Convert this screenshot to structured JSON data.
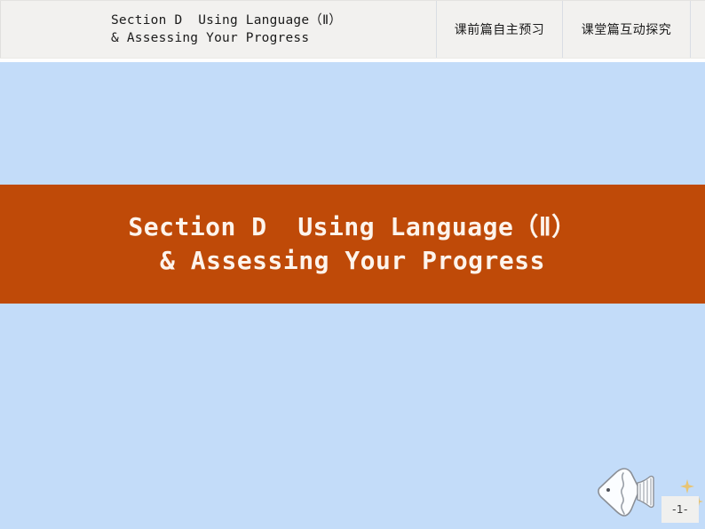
{
  "header": {
    "title_line1": "Section D  Using Language（Ⅱ）",
    "title_line2": "& Assessing Your Progress",
    "tabs": [
      {
        "label": "课前篇自主预习"
      },
      {
        "label": "课堂篇互动探究"
      }
    ]
  },
  "banner": {
    "line1": "Section D  Using Language（Ⅱ）",
    "line2": "& Assessing Your Progress"
  },
  "footer": {
    "page_number": "-1-"
  },
  "decorations": {
    "fish_icon": "fish-icon",
    "sparkle_icon": "sparkle-star-icon"
  },
  "colors": {
    "header_background": "#f2f1ef",
    "body_blue": "#c3dcf9",
    "banner_orange": "#bf4a08",
    "banner_text": "#fdf4ec",
    "header_text": "#1b1b1b",
    "sparkle_gold": "#e8c473",
    "page_number_background": "#f0f0ee"
  }
}
